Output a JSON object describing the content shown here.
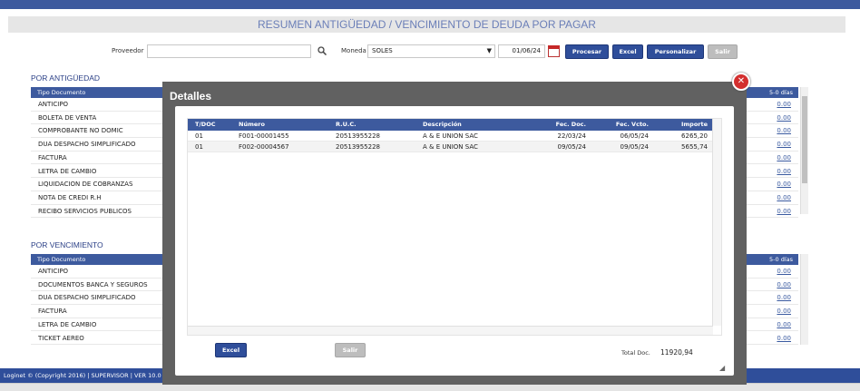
{
  "page": {
    "title": "RESUMEN ANTIGÜEDAD / VENCIMIENTO DE DEUDA POR PAGAR"
  },
  "filters": {
    "proveedor_label": "Proveedor",
    "proveedor_value": "",
    "moneda_label": "Moneda",
    "moneda_value": "SOLES",
    "fecha_value": "01/06/24",
    "procesar_label": "Procesar",
    "excel_label": "Excel",
    "personalizar_label": "Personalizar",
    "salir_label": "Salir"
  },
  "antiguedad": {
    "title": "POR ANTIGÜEDAD",
    "col_tipo": "Tipo Documento",
    "col_right": "5-0 días",
    "rows": [
      {
        "tipo": "ANTICIPO",
        "valor": "0.00"
      },
      {
        "tipo": "BOLETA DE VENTA",
        "valor": "0.00"
      },
      {
        "tipo": "COMPROBANTE NO DOMIC",
        "valor": "0.00"
      },
      {
        "tipo": "DUA DESPACHO SIMPLIFICADO",
        "valor": "0.00"
      },
      {
        "tipo": "FACTURA",
        "valor": "0.00"
      },
      {
        "tipo": "LETRA DE CAMBIO",
        "valor": "0.00"
      },
      {
        "tipo": "LIQUIDACION DE COBRANZAS",
        "valor": "0.00"
      },
      {
        "tipo": "NOTA DE CREDI R.H",
        "valor": "0.00"
      },
      {
        "tipo": "RECIBO SERVICIOS PUBLICOS",
        "valor": "0.00"
      }
    ]
  },
  "vencimiento": {
    "title": "POR VENCIMIENTO",
    "col_tipo": "Tipo Documento",
    "col_right": "5-0 días",
    "rows": [
      {
        "tipo": "ANTICIPO",
        "valor": "0.00"
      },
      {
        "tipo": "DOCUMENTOS BANCA Y SEGUROS",
        "valor": "0.00"
      },
      {
        "tipo": "DUA DESPACHO SIMPLIFICADO",
        "valor": "0.00"
      },
      {
        "tipo": "FACTURA",
        "valor": "0.00"
      },
      {
        "tipo": "LETRA DE CAMBIO",
        "valor": "0.00"
      },
      {
        "tipo": "TICKET AEREO",
        "valor": "0.00"
      }
    ]
  },
  "footer": {
    "text": "Loginet © (Copyright 2016) | SUPERVISOR | VER 10.0"
  },
  "modal": {
    "title": "Detalles",
    "close_glyph": "✕",
    "columns": {
      "tdoc": "T/DOC",
      "numero": "Número",
      "ruc": "R.U.C.",
      "descripcion": "Descripción",
      "fec_doc": "Fec. Doc.",
      "fec_vcto": "Fec. Vcto.",
      "importe": "Importe"
    },
    "rows": [
      {
        "tdoc": "01",
        "numero": "F001-00001455",
        "ruc": "20513955228",
        "descripcion": "A & E UNION SAC",
        "fec_doc": "22/03/24",
        "fec_vcto": "06/05/24",
        "importe": "6265,20"
      },
      {
        "tdoc": "01",
        "numero": "F002-00004567",
        "ruc": "20513955228",
        "descripcion": "A & E UNION SAC",
        "fec_doc": "09/05/24",
        "fec_vcto": "09/05/24",
        "importe": "5655,74"
      }
    ],
    "excel_label": "Excel",
    "salir_label": "Salir",
    "total_label": "Total Doc.",
    "total_value": "11920,94"
  }
}
